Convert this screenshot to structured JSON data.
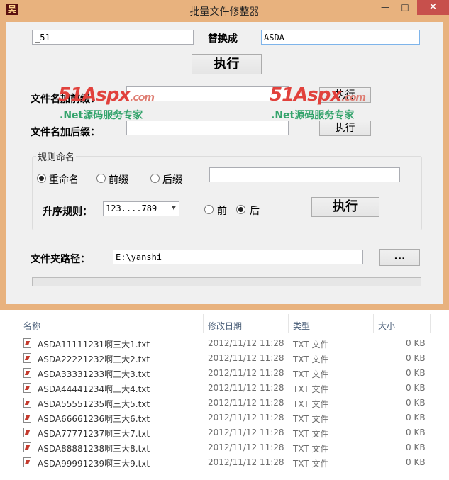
{
  "window": {
    "title": "批量文件修整器",
    "app_icon": "吴",
    "controls": {
      "minimize": "—",
      "maximize": "□",
      "close": "✕"
    }
  },
  "replace": {
    "find_value": "_51",
    "label": "替换成",
    "replace_value": "ASDA",
    "execute_label": "执行"
  },
  "prefix": {
    "label": "文件名加前缀：",
    "value": "",
    "execute_label": "执行"
  },
  "suffix": {
    "label": "文件名加后缀：",
    "value": "",
    "execute_label": "执行"
  },
  "rule": {
    "group_title": "规则命名",
    "options": [
      {
        "label": "重命名",
        "checked": true
      },
      {
        "label": "前缀",
        "checked": false
      },
      {
        "label": "后缀",
        "checked": false
      }
    ],
    "rule_value": "",
    "order_label": "升序规则：",
    "order_value": "123....789",
    "position_options": [
      {
        "label": "前",
        "checked": false
      },
      {
        "label": "后",
        "checked": true
      }
    ],
    "execute_label": "执行"
  },
  "folder": {
    "label": "文件夹路径：",
    "value": "E:\\yanshi",
    "browse_label": "..."
  },
  "progress": {
    "value": 0
  },
  "watermark": {
    "brand": "51Aspx",
    "domain": ".com",
    "tagline": ".Net源码服务专家"
  },
  "explorer": {
    "columns": [
      "名称",
      "修改日期",
      "类型",
      "大小"
    ],
    "rows": [
      {
        "name": "ASDA11111231啊三大1.txt",
        "date": "2012/11/12 11:28",
        "type": "TXT 文件",
        "size": "0 KB"
      },
      {
        "name": "ASDA22221232啊三大2.txt",
        "date": "2012/11/12 11:28",
        "type": "TXT 文件",
        "size": "0 KB"
      },
      {
        "name": "ASDA33331233啊三大3.txt",
        "date": "2012/11/12 11:28",
        "type": "TXT 文件",
        "size": "0 KB"
      },
      {
        "name": "ASDA44441234啊三大4.txt",
        "date": "2012/11/12 11:28",
        "type": "TXT 文件",
        "size": "0 KB"
      },
      {
        "name": "ASDA55551235啊三大5.txt",
        "date": "2012/11/12 11:28",
        "type": "TXT 文件",
        "size": "0 KB"
      },
      {
        "name": "ASDA66661236啊三大6.txt",
        "date": "2012/11/12 11:28",
        "type": "TXT 文件",
        "size": "0 KB"
      },
      {
        "name": "ASDA77771237啊三大7.txt",
        "date": "2012/11/12 11:28",
        "type": "TXT 文件",
        "size": "0 KB"
      },
      {
        "name": "ASDA88881238啊三大8.txt",
        "date": "2012/11/12 11:28",
        "type": "TXT 文件",
        "size": "0 KB"
      },
      {
        "name": "ASDA99991239啊三大9.txt",
        "date": "2012/11/12 11:28",
        "type": "TXT 文件",
        "size": "0 KB"
      }
    ]
  },
  "colors": {
    "frame": "#e8b27e",
    "close_button": "#c7504c",
    "progress_fill": "#06b025",
    "watermark_red": "#e1413c",
    "watermark_green": "#33a36b"
  }
}
